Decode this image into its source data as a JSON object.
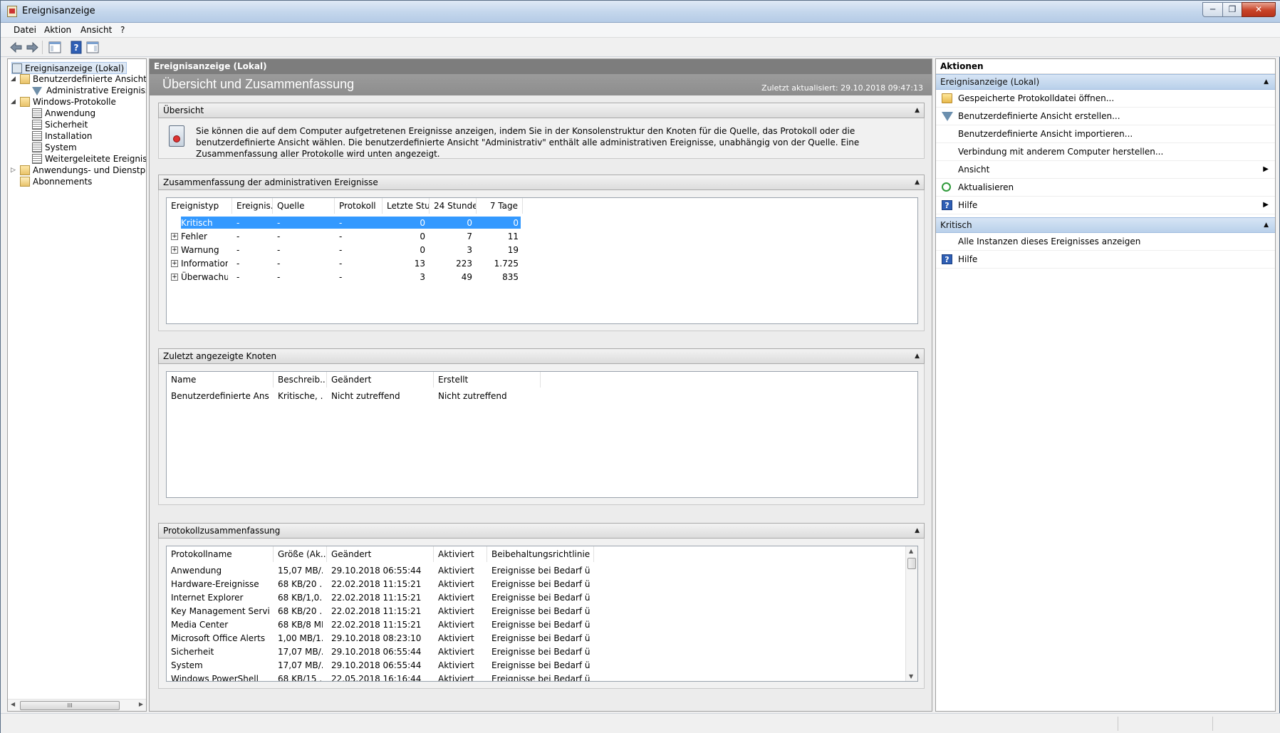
{
  "window": {
    "title": "Ereignisanzeige",
    "minimize": "0",
    "maximize": "1",
    "close": "r"
  },
  "menubar": {
    "items": [
      "Datei",
      "Aktion",
      "Ansicht",
      "?"
    ]
  },
  "toolbar": {
    "icons": [
      "back-arrow-icon",
      "forward-arrow-icon",
      "show-tree-icon",
      "help-icon",
      "action-pane-icon"
    ]
  },
  "tree": {
    "items": [
      {
        "label": "Ereignisanzeige (Lokal)",
        "icon": "computer-icon",
        "level": 0,
        "expander": "",
        "selected": true
      },
      {
        "label": "Benutzerdefinierte Ansichten",
        "icon": "folder-icon",
        "level": 1,
        "expander": "◢"
      },
      {
        "label": "Administrative Ereignisse",
        "icon": "filter-icon",
        "level": 2,
        "expander": ""
      },
      {
        "label": "Windows-Protokolle",
        "icon": "folder-icon",
        "level": 1,
        "expander": "◢"
      },
      {
        "label": "Anwendung",
        "icon": "log-icon",
        "level": 2,
        "expander": ""
      },
      {
        "label": "Sicherheit",
        "icon": "log-icon",
        "level": 2,
        "expander": ""
      },
      {
        "label": "Installation",
        "icon": "log-icon",
        "level": 2,
        "expander": ""
      },
      {
        "label": "System",
        "icon": "log-icon",
        "level": 2,
        "expander": ""
      },
      {
        "label": "Weitergeleitete Ereignisse",
        "icon": "log-icon",
        "level": 2,
        "expander": ""
      },
      {
        "label": "Anwendungs- und Dienstprotokolle",
        "icon": "folder-icon",
        "level": 1,
        "expander": "▷"
      },
      {
        "label": "Abonnements",
        "icon": "subscription-icon",
        "level": 1,
        "expander": ""
      }
    ],
    "scroll_thumb": "III"
  },
  "center": {
    "header": "Ereignisanzeige (Lokal)",
    "banner_title": "Übersicht und Zusammenfassung",
    "last_updated": "Zuletzt aktualisiert: 29.10.2018 09:47:13",
    "collapse_glyph": "▲",
    "overview": {
      "title": "Übersicht",
      "text": "Sie können die auf dem Computer aufgetretenen Ereignisse anzeigen, indem Sie in der Konsolenstruktur den Knoten für die Quelle, das Protokoll oder die benutzerdefinierte Ansicht wählen. Die benutzerdefinierte Ansicht \"Administrativ\" enthält alle administrativen Ereignisse, unabhängig von der Quelle. Eine Zusammenfassung aller Protokolle wird unten angezeigt."
    },
    "admin_summary": {
      "title": "Zusammenfassung der administrativen Ereignisse",
      "columns": [
        "Ereignistyp",
        "Ereignis...",
        "Quelle",
        "Protokoll",
        "Letzte Stu...",
        "24 Stunden",
        "7 Tage"
      ],
      "rows": [
        {
          "type": "Kritisch",
          "event": "-",
          "source": "-",
          "log": "-",
          "hour": "0",
          "day": "0",
          "week": "0",
          "expandable": false,
          "selected": true
        },
        {
          "type": "Fehler",
          "event": "-",
          "source": "-",
          "log": "-",
          "hour": "0",
          "day": "7",
          "week": "11",
          "expandable": true
        },
        {
          "type": "Warnung",
          "event": "-",
          "source": "-",
          "log": "-",
          "hour": "0",
          "day": "3",
          "week": "19",
          "expandable": true
        },
        {
          "type": "Informationen",
          "event": "-",
          "source": "-",
          "log": "-",
          "hour": "13",
          "day": "223",
          "week": "1.725",
          "expandable": true
        },
        {
          "type": "Überwachun...",
          "event": "-",
          "source": "-",
          "log": "-",
          "hour": "3",
          "day": "49",
          "week": "835",
          "expandable": true
        }
      ]
    },
    "recent_nodes": {
      "title": "Zuletzt angezeigte Knoten",
      "columns": [
        "Name",
        "Beschreib...",
        "Geändert",
        "Erstellt"
      ],
      "rows": [
        {
          "name": "Benutzerdefinierte Ansic...",
          "desc": "Kritische, ...",
          "changed": "Nicht zutreffend",
          "created": "Nicht zutreffend"
        }
      ]
    },
    "log_summary": {
      "title": "Protokollzusammenfassung",
      "columns": [
        "Protokollname",
        "Größe (Ak...",
        "Geändert",
        "Aktiviert",
        "Beibehaltungsrichtlinie"
      ],
      "rows": [
        {
          "name": "Anwendung",
          "size": "15,07 MB/...",
          "changed": "29.10.2018 06:55:44",
          "enabled": "Aktiviert",
          "policy": "Ereignisse bei Bedarf üb..."
        },
        {
          "name": "Hardware-Ereignisse",
          "size": "68 KB/20 ...",
          "changed": "22.02.2018 11:15:21",
          "enabled": "Aktiviert",
          "policy": "Ereignisse bei Bedarf üb..."
        },
        {
          "name": "Internet Explorer",
          "size": "68 KB/1,0...",
          "changed": "22.02.2018 11:15:21",
          "enabled": "Aktiviert",
          "policy": "Ereignisse bei Bedarf üb..."
        },
        {
          "name": "Key Management Service",
          "size": "68 KB/20 ...",
          "changed": "22.02.2018 11:15:21",
          "enabled": "Aktiviert",
          "policy": "Ereignisse bei Bedarf üb..."
        },
        {
          "name": "Media Center",
          "size": "68 KB/8 MB",
          "changed": "22.02.2018 11:15:21",
          "enabled": "Aktiviert",
          "policy": "Ereignisse bei Bedarf üb..."
        },
        {
          "name": "Microsoft Office Alerts",
          "size": "1,00 MB/1...",
          "changed": "29.10.2018 08:23:10",
          "enabled": "Aktiviert",
          "policy": "Ereignisse bei Bedarf üb..."
        },
        {
          "name": "Sicherheit",
          "size": "17,07 MB/...",
          "changed": "29.10.2018 06:55:44",
          "enabled": "Aktiviert",
          "policy": "Ereignisse bei Bedarf üb..."
        },
        {
          "name": "System",
          "size": "17,07 MB/...",
          "changed": "29.10.2018 06:55:44",
          "enabled": "Aktiviert",
          "policy": "Ereignisse bei Bedarf üb..."
        },
        {
          "name": "Windows PowerShell",
          "size": "68 KB/15 ...",
          "changed": "22.05.2018 16:16:44",
          "enabled": "Aktiviert",
          "policy": "Ereignisse bei Bedarf üb..."
        }
      ]
    }
  },
  "actions": {
    "header": "Aktionen",
    "sections": [
      {
        "title": "Ereignisanzeige (Lokal)",
        "items": [
          {
            "label": "Gespeicherte Protokolldatei öffnen...",
            "icon": "open-folder-icon",
            "submenu": false
          },
          {
            "label": "Benutzerdefinierte Ansicht erstellen...",
            "icon": "filter-icon",
            "submenu": false
          },
          {
            "label": "Benutzerdefinierte Ansicht importieren...",
            "icon": "",
            "submenu": false
          },
          {
            "label": "Verbindung mit anderem Computer herstellen...",
            "icon": "",
            "submenu": false
          },
          {
            "label": "Ansicht",
            "icon": "",
            "submenu": true
          },
          {
            "label": "Aktualisieren",
            "icon": "refresh-icon",
            "submenu": false
          },
          {
            "label": "Hilfe",
            "icon": "help-icon",
            "submenu": true
          }
        ]
      },
      {
        "title": "Kritisch",
        "items": [
          {
            "label": "Alle Instanzen dieses Ereignisses anzeigen",
            "icon": "",
            "submenu": false
          },
          {
            "label": "Hilfe",
            "icon": "help-icon",
            "submenu": false
          }
        ]
      }
    ],
    "submenu_glyph": "▶"
  },
  "colors": {
    "selection": "#3399ff",
    "center_header": "#7d7d7d",
    "action_section": "#c5d9f0"
  }
}
